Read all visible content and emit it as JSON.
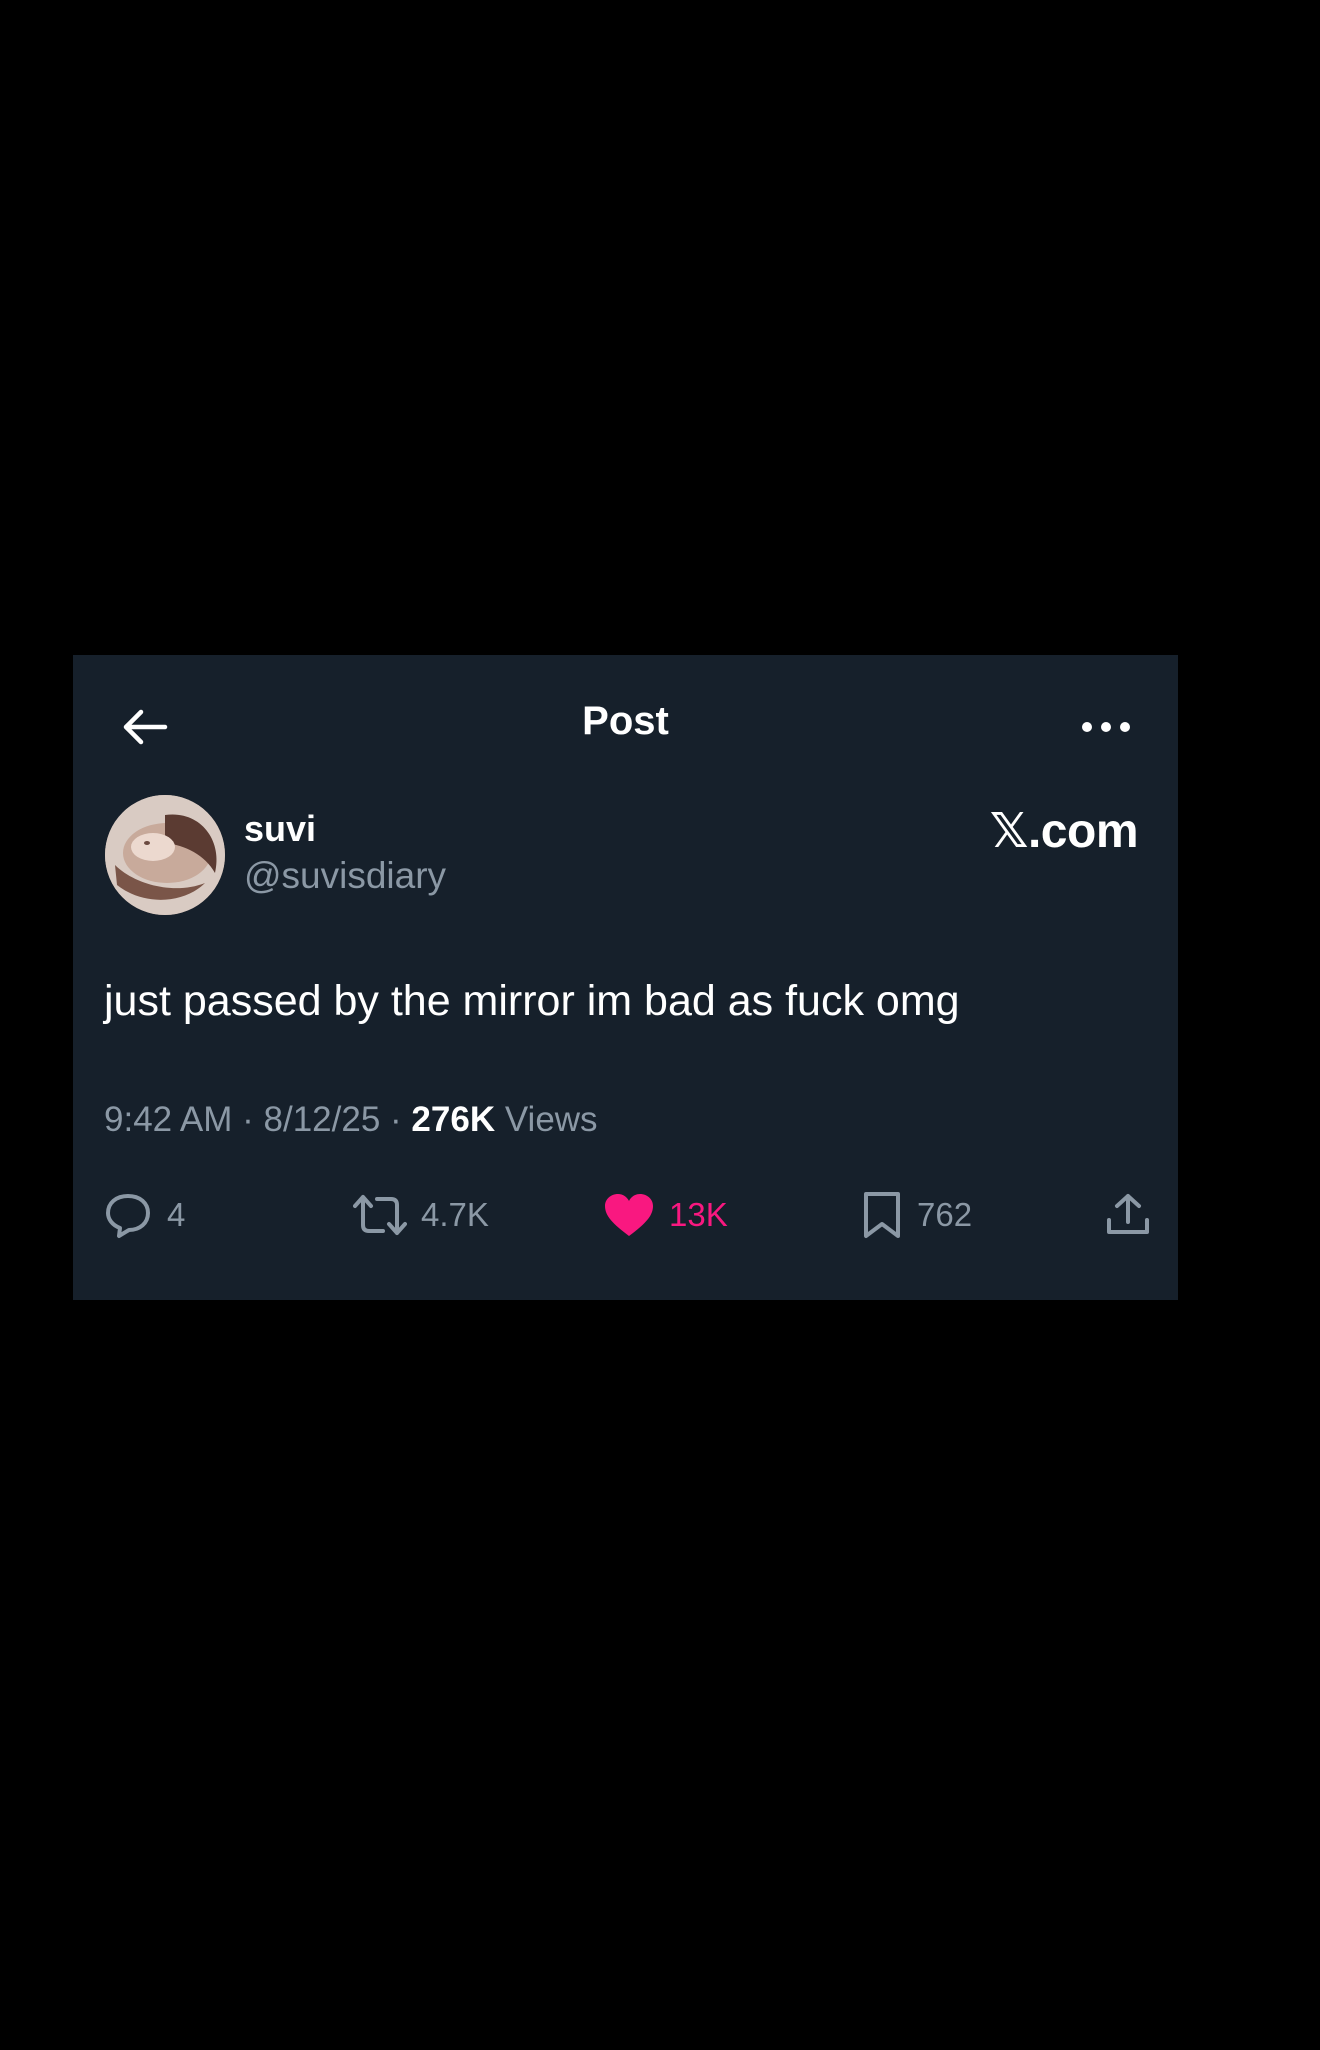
{
  "header": {
    "title": "Post",
    "back_icon": "arrow-left-icon",
    "more_icon": "more-horizontal-icon"
  },
  "author": {
    "display_name": "suvi",
    "handle": "@suvisdiary"
  },
  "brand": "𝕏.com",
  "post": {
    "text": "just passed by the mirror im bad as fuck omg",
    "time": "9:42 AM",
    "date": "8/12/25",
    "views_count": "276K",
    "views_label": "Views"
  },
  "actions": {
    "replies": "4",
    "reposts": "4.7K",
    "likes": "13K",
    "bookmarks": "762"
  },
  "colors": {
    "card_bg": "#16202b",
    "like": "#f91880",
    "muted": "#8b98a5"
  }
}
